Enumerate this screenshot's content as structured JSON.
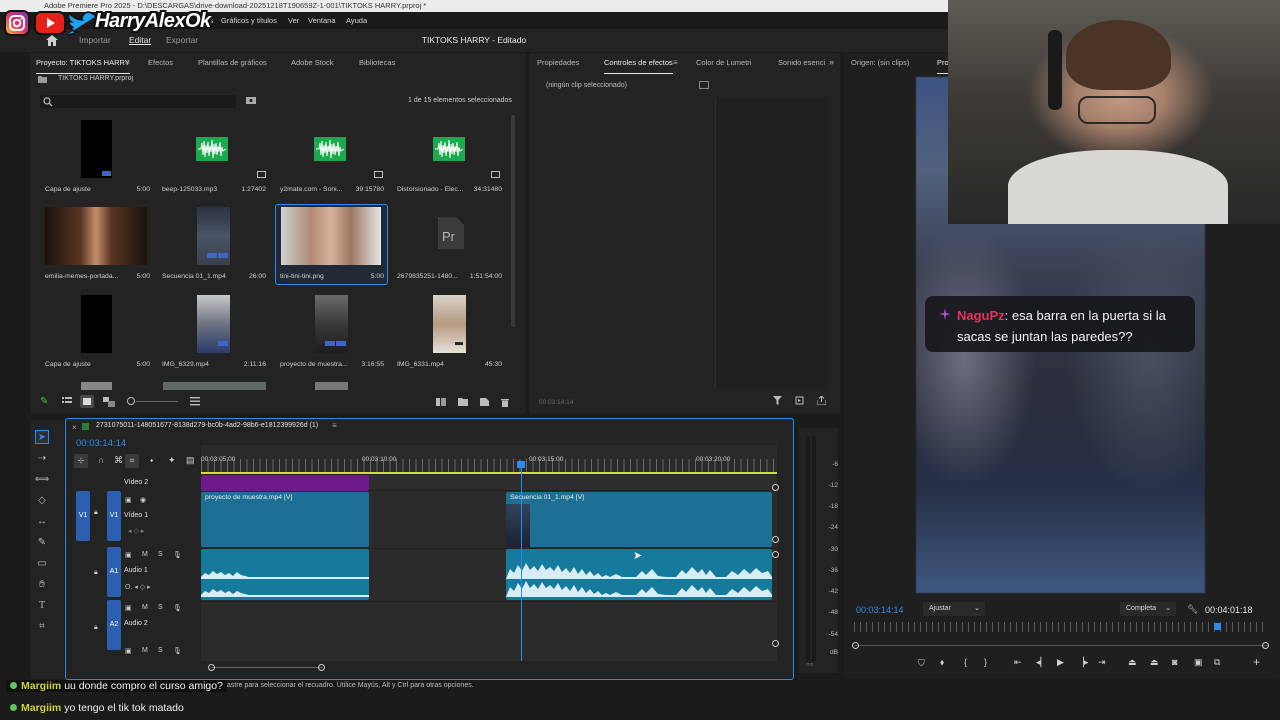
{
  "app": {
    "title_bar": "Adobe Premiere Pro 2025 - D:\\DESCARGAS\\drive-download-20251218T190659Z-1-001\\TIKTOKS HARRY.prproj *",
    "menu": [
      "res",
      "Gráficos y títulos",
      "Ver",
      "Ventana",
      "Ayuda"
    ],
    "workspaces": [
      "Importar",
      "Editar",
      "Exportar"
    ],
    "project_title": "TIKTOKS HARRY - Editado"
  },
  "overlay": {
    "channel_name": "HarryAlexOk",
    "socials": [
      "instagram-icon",
      "youtube-icon",
      "twitter-icon"
    ]
  },
  "project_panel": {
    "tabs": [
      "Proyecto: TIKTOKS HARRY",
      "Efectos",
      "Plantillas de gráficos",
      "Adobe Stock",
      "Bibliotecas"
    ],
    "file": "TIKTOKS HARRY.prproj",
    "selection_info": "1 de 15 elementos seleccionados",
    "items": [
      {
        "name": "Capa de ajuste",
        "duration": "5:00"
      },
      {
        "name": "beep-125033.mp3",
        "duration": "1:27402"
      },
      {
        "name": "y2mate.com - Soni...",
        "duration": "39:15780"
      },
      {
        "name": "Distorsionado - Elec...",
        "duration": "34:31480"
      },
      {
        "name": "emilia-memes-portada...",
        "duration": "5:00"
      },
      {
        "name": "Secuencia 01_1.mp4",
        "duration": "26:00"
      },
      {
        "name": "tini-tini-tini.png",
        "duration": "5:00"
      },
      {
        "name": "2679835251-1480...",
        "duration": "1:51:54:00"
      },
      {
        "name": "Capa de ajuste",
        "duration": "5:00"
      },
      {
        "name": "IMG_6329.mp4",
        "duration": "2:11:16"
      },
      {
        "name": "proyecto de muestra...",
        "duration": "3:16:55"
      },
      {
        "name": "IMG_6331.mp4",
        "duration": "45:30"
      }
    ]
  },
  "effects_panel": {
    "tabs": [
      "Propiedades",
      "Controles de efectos",
      "Color de Lumetri",
      "Sonido esenci"
    ],
    "no_clip": "(ningún clip seleccionado)",
    "timecode": "00:03:14:14"
  },
  "source_monitor": {
    "tab": "Origen: (sin clips)",
    "tab2": "Pro",
    "timecode_left": "00:03:14:14",
    "fit": "Ajustar",
    "quality": "Completa",
    "timecode_right": "00:04:01:18"
  },
  "timeline": {
    "sequence": "2731075011-148051677-8138d279-bc0b-4ad2-98b6-e1812399926d (1)",
    "timecode": "00:03:14:14",
    "ruler": [
      "00:03:05:00",
      "00:03:10:00",
      "00:03:15:00",
      "00:03:20:00"
    ],
    "tracks": {
      "v2": "Vídeo 2",
      "v1_src": "V1",
      "v1": "V1",
      "v1_name": "Vídeo 1",
      "a1": "A1",
      "a1_name": "Audio 1",
      "a2": "A2",
      "a2_name": "Audio 2"
    },
    "clips": {
      "v1a": "proyecto de muestra.mp4 [V]",
      "v1b": "Secuencia 01_1.mp4 [V]"
    },
    "meter_scale": [
      "-6",
      "-12",
      "-18",
      "-24",
      "-30",
      "-36",
      "-42",
      "-48",
      "-54",
      "dB"
    ]
  },
  "status_bar": "astre para seleccionar el recuadro. Utilice Mayús, Alt y Ctrl para otras opciones.",
  "chat_overlay": {
    "user": "NaguPz",
    "message": ": esa barra en la puerta si la sacas se juntan las paredes??"
  },
  "chat": [
    {
      "user": "Margiim",
      "message": "uu donde compro el curso amigo?"
    },
    {
      "user": "Margiim",
      "message": "yo tengo el tik tok matado"
    }
  ],
  "colors": {
    "clip_video": "#1d6f94",
    "clip_audio": "#157a9c",
    "adjust_layer": "#6f1a8c",
    "accent": "#2d8ceb",
    "chat_name": "#cdd13a"
  }
}
